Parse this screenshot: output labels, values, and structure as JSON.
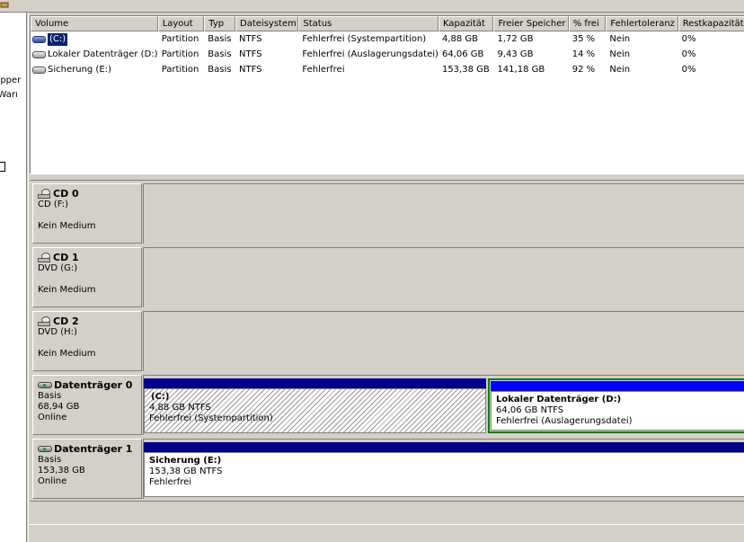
{
  "left_pane": {
    "fragments": [
      "upper",
      "d Warı"
    ]
  },
  "volume_list": {
    "columns": [
      "Volume",
      "Layout",
      "Typ",
      "Dateisystem",
      "Status",
      "Kapazität",
      "Freier Speicher",
      "% frei",
      "Fehlertoleranz",
      "Restkapazität"
    ],
    "rows": [
      {
        "volume": "(C:)",
        "layout": "Partition",
        "typ": "Basis",
        "dateisystem": "NTFS",
        "status": "Fehlerfrei (Systempartition)",
        "kapazitaet": "4,88 GB",
        "frei": "1,72 GB",
        "prozent": "35 %",
        "fehlertoleranz": "Nein",
        "rest": "0%",
        "selected": true
      },
      {
        "volume": "Lokaler Datenträger (D:)",
        "layout": "Partition",
        "typ": "Basis",
        "dateisystem": "NTFS",
        "status": "Fehlerfrei (Auslagerungsdatei)",
        "kapazitaet": "64,06 GB",
        "frei": "9,43 GB",
        "prozent": "14 %",
        "fehlertoleranz": "Nein",
        "rest": "0%",
        "selected": false
      },
      {
        "volume": "Sicherung (E:)",
        "layout": "Partition",
        "typ": "Basis",
        "dateisystem": "NTFS",
        "status": "Fehlerfrei",
        "kapazitaet": "153,38 GB",
        "frei": "141,18 GB",
        "prozent": "92 %",
        "fehlertoleranz": "Nein",
        "rest": "0%",
        "selected": false
      }
    ]
  },
  "disks": [
    {
      "icon": "cd-drive-icon",
      "name": "CD 0",
      "line1": "CD (F:)",
      "line2": "",
      "line3": "Kein Medium"
    },
    {
      "icon": "cd-drive-icon",
      "name": "CD 1",
      "line1": "DVD (G:)",
      "line2": "",
      "line3": "Kein Medium"
    },
    {
      "icon": "cd-drive-icon",
      "name": "CD 2",
      "line1": "DVD (H:)",
      "line2": "",
      "line3": "Kein Medium"
    },
    {
      "icon": "hard-disk-icon",
      "name": "Datenträger 0",
      "line1": "Basis",
      "line2": "68,94 GB",
      "line3": "Online",
      "partitions": [
        {
          "name": "(C:)",
          "size": "4,88 GB NTFS",
          "status": "Fehlerfrei (Systempartition)",
          "hatched": true,
          "selected": false
        },
        {
          "name": "Lokaler Datenträger  (D:)",
          "size": "64,06 GB NTFS",
          "status": "Fehlerfrei (Auslagerungsdatei)",
          "hatched": false,
          "selected": true
        }
      ]
    },
    {
      "icon": "hard-disk-icon",
      "name": "Datenträger 1",
      "line1": "Basis",
      "line2": "153,38 GB",
      "line3": "Online",
      "partitions": [
        {
          "name": "Sicherung  (E:)",
          "size": "153,38 GB NTFS",
          "status": "Fehlerfrei",
          "hatched": false,
          "selected": false
        }
      ]
    }
  ],
  "colors": {
    "primary_partition_bar": "#00008b",
    "selected_border": "#008000",
    "selection_highlight": "#0a246a"
  }
}
